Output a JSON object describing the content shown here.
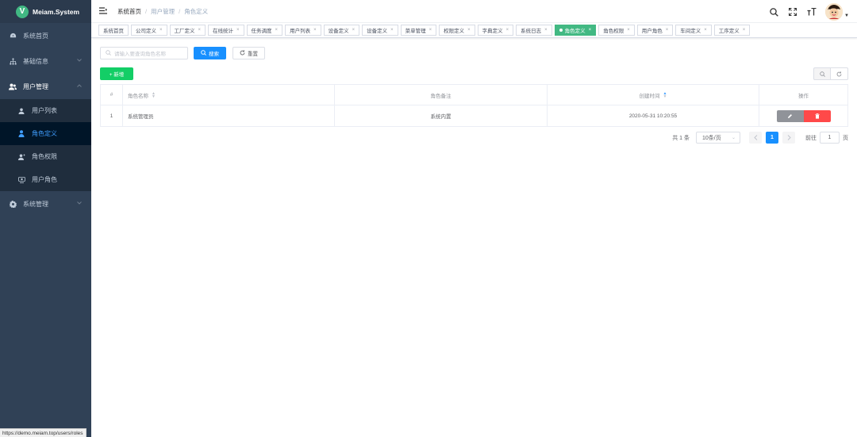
{
  "app": {
    "logo_letter": "V",
    "title": "Meiam.System"
  },
  "sidebar": {
    "items": [
      {
        "label": "系统首页",
        "icon": "dashboard-icon"
      },
      {
        "label": "基础信息",
        "icon": "tree-icon"
      },
      {
        "label": "用户管理",
        "icon": "users-icon"
      },
      {
        "label": "系统管理",
        "icon": "gear-icon"
      }
    ],
    "sub": [
      {
        "label": "用户列表",
        "icon": "user-icon"
      },
      {
        "label": "角色定义",
        "icon": "role-icon"
      },
      {
        "label": "角色权限",
        "icon": "role-perm-icon"
      },
      {
        "label": "用户角色",
        "icon": "user-role-icon"
      }
    ]
  },
  "breadcrumb": {
    "home": "系统首页",
    "sep": "/",
    "level1": "用户管理",
    "level2": "角色定义"
  },
  "tags": [
    {
      "label": "系统首页",
      "closable": false
    },
    {
      "label": "公司定义",
      "closable": true
    },
    {
      "label": "工厂定义",
      "closable": true
    },
    {
      "label": "在线统计",
      "closable": true
    },
    {
      "label": "任务调度",
      "closable": true
    },
    {
      "label": "用户列表",
      "closable": true
    },
    {
      "label": "设备定义",
      "closable": true
    },
    {
      "label": "设备定义",
      "closable": true
    },
    {
      "label": "菜单管理",
      "closable": true
    },
    {
      "label": "权限定义",
      "closable": true
    },
    {
      "label": "字典定义",
      "closable": true
    },
    {
      "label": "系统日志",
      "closable": true
    },
    {
      "label": "角色定义",
      "closable": true,
      "active": true
    },
    {
      "label": "角色权限",
      "closable": true
    },
    {
      "label": "用户角色",
      "closable": true
    },
    {
      "label": "车间定义",
      "closable": true
    },
    {
      "label": "工序定义",
      "closable": true
    }
  ],
  "tag_close": "×",
  "search": {
    "placeholder": "请输入要查询角色名称",
    "search_label": "搜索",
    "reset_label": "重置"
  },
  "toolbar": {
    "add_label": "+ 新增"
  },
  "table": {
    "headers": {
      "index": "#",
      "name": "角色名称",
      "remark": "角色备注",
      "time": "创建时间",
      "ops": "操作"
    },
    "rows": [
      {
        "index": "1",
        "name": "系统管理员",
        "remark": "系统内置",
        "time": "2020-05-31 10:20:55"
      }
    ]
  },
  "pagination": {
    "total": "共 1 条",
    "page_size": "10条/页",
    "current": "1",
    "goto_prefix": "前往",
    "goto_value": "1",
    "goto_suffix": "页"
  },
  "statusbar": {
    "url": "https://demo.meiam.top/users/roles"
  },
  "colors": {
    "sidebar": "#304156",
    "primary": "#1890ff",
    "success": "#13ce66",
    "danger": "#ff4949",
    "tag_active": "#42b983"
  }
}
